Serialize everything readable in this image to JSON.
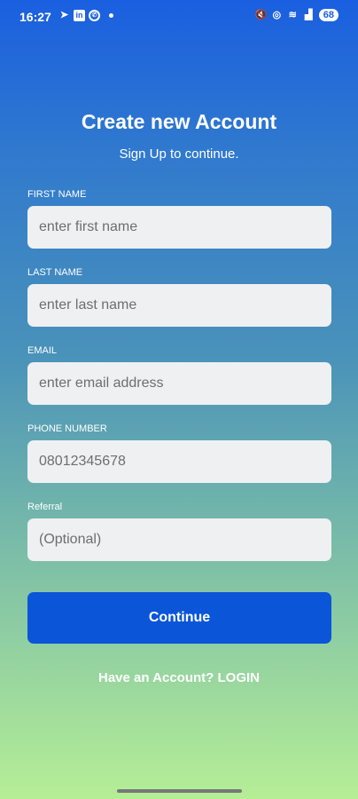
{
  "status_bar": {
    "time": "16:27",
    "battery": "68",
    "icons_left": [
      "telegram-icon",
      "linkedin-icon",
      "whatsapp-icon",
      "dot-icon"
    ],
    "icons_right": [
      "mute-icon",
      "hotspot-icon",
      "wifi-icon",
      "signal-icon",
      "battery-icon"
    ]
  },
  "header": {
    "title": "Create new Account",
    "subtitle": "Sign Up to continue."
  },
  "form": {
    "first_name": {
      "label": "FIRST NAME",
      "placeholder": "enter first name",
      "value": ""
    },
    "last_name": {
      "label": "LAST NAME",
      "placeholder": "enter last name",
      "value": ""
    },
    "email": {
      "label": "EMAIL",
      "placeholder": "enter email address",
      "value": ""
    },
    "phone": {
      "label": "PHONE NUMBER",
      "placeholder": "08012345678",
      "value": ""
    },
    "referral": {
      "label": "Referral",
      "placeholder": "(Optional)",
      "value": ""
    }
  },
  "actions": {
    "continue_label": "Continue",
    "login_prompt": "Have an Account?",
    "login_label": "LOGIN"
  },
  "colors": {
    "gradient_top": "#1a5fe0",
    "gradient_bottom": "#b6ee96",
    "button": "#0b55d9",
    "field_bg": "#eef0f2"
  }
}
